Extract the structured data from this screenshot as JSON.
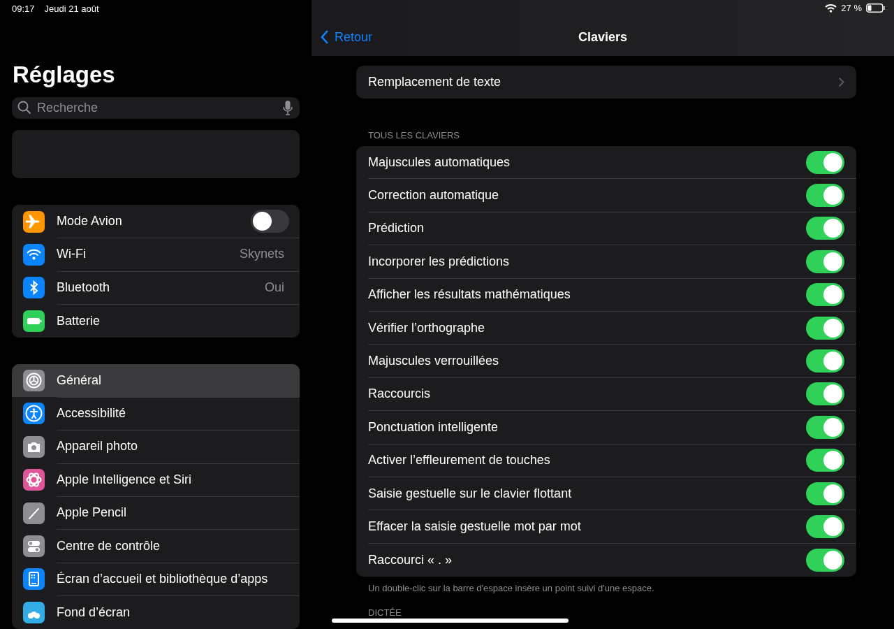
{
  "status_bar": {
    "time": "09:17",
    "date": "Jeudi 21 août",
    "battery_text": "27 %"
  },
  "sidebar": {
    "title": "Réglages",
    "search": {
      "placeholder": "Recherche"
    },
    "groups": [
      {
        "items": [
          {
            "label": "Mode Avion",
            "color": "#ff9500",
            "kind": "toggle",
            "on": false
          },
          {
            "label": "Wi-Fi",
            "color": "#0a84ff",
            "kind": "value",
            "value": "Skynets"
          },
          {
            "label": "Bluetooth",
            "color": "#0a84ff",
            "kind": "value",
            "value": "Oui"
          },
          {
            "label": "Batterie",
            "color": "#30d158",
            "kind": "plain"
          }
        ]
      },
      {
        "items": [
          {
            "label": "Général",
            "color": "#8e8e93",
            "kind": "plain",
            "selected": true
          },
          {
            "label": "Accessibilité",
            "color": "#0a84ff",
            "kind": "plain",
            "selected": false
          },
          {
            "label": "Appareil photo",
            "color": "#8e8e93",
            "kind": "plain",
            "selected": false
          },
          {
            "label": "Apple Intelligence et Siri",
            "color": "#e0559a",
            "kind": "plain",
            "selected": false
          },
          {
            "label": "Apple Pencil",
            "color": "#8e8e93",
            "kind": "plain",
            "selected": false
          },
          {
            "label": "Centre de contrôle",
            "color": "#8e8e93",
            "kind": "plain",
            "selected": false
          },
          {
            "label": "Écran d’accueil et bibliothèque d’apps",
            "color": "#0a84ff",
            "kind": "plain",
            "selected": false
          },
          {
            "label": "Fond d’écran",
            "color": "#32ade6",
            "kind": "plain",
            "selected": false
          }
        ]
      }
    ]
  },
  "detail": {
    "back": "Retour",
    "title": "Claviers",
    "link_row": {
      "label": "Remplacement de texte"
    },
    "section_header": "TOUS LES CLAVIERS",
    "settings": [
      {
        "label": "Majuscules automatiques",
        "on": true
      },
      {
        "label": "Correction automatique",
        "on": true
      },
      {
        "label": "Prédiction",
        "on": true
      },
      {
        "label": "Incorporer les prédictions",
        "on": true
      },
      {
        "label": "Afficher les résultats mathématiques",
        "on": true
      },
      {
        "label": "Vérifier l’orthographe",
        "on": true
      },
      {
        "label": "Majuscules verrouillées",
        "on": true
      },
      {
        "label": "Raccourcis",
        "on": true
      },
      {
        "label": "Ponctuation intelligente",
        "on": true
      },
      {
        "label": "Activer l’effleurement de touches",
        "on": true
      },
      {
        "label": "Saisie gestuelle sur le clavier flottant",
        "on": true
      },
      {
        "label": "Effacer la saisie gestuelle mot par mot",
        "on": true
      },
      {
        "label": "Raccourci « . »",
        "on": true
      }
    ],
    "footer": "Un double-clic sur la barre d'espace insère un point suivi d'une espace.",
    "next_section_header": "DICTÉE"
  }
}
